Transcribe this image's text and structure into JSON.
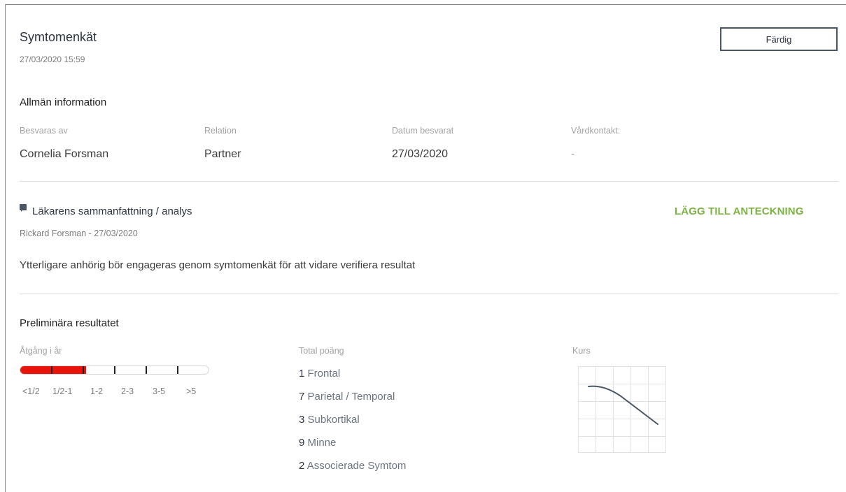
{
  "header": {
    "title": "Symtomenkät",
    "timestamp": "27/03/2020 15:59",
    "done_label": "Färdig"
  },
  "general": {
    "heading": "Allmän information",
    "fields": [
      {
        "label": "Besvaras av",
        "value": "Cornelia Forsman"
      },
      {
        "label": "Relation",
        "value": "Partner"
      },
      {
        "label": "Datum besvarat",
        "value": "27/03/2020"
      },
      {
        "label": "Vårdkontakt:",
        "value": "-"
      }
    ]
  },
  "summary": {
    "icon": "comment-icon",
    "heading": "Läkarens sammanfattning / analys",
    "add_note_label": "LÄGG TILL ANTECKNING",
    "author": "Rickard Forsman - 27/03/2020",
    "text": "Ytterligare anhörig bör engageras genom symtomenkät för att vidare verifiera resultat"
  },
  "results": {
    "heading": "Preliminära resultatet",
    "progression": {
      "label": "Åtgång i år",
      "scale": [
        "<1/2",
        "1/2-1",
        "1-2",
        "2-3",
        "3-5",
        ">5"
      ],
      "filled_segments": 2,
      "total_segments": 6,
      "fill_color": "#e8130b"
    },
    "total": {
      "label": "Total poäng",
      "items": [
        {
          "score": "1",
          "name": "Frontal"
        },
        {
          "score": "7",
          "name": "Parietal / Temporal"
        },
        {
          "score": "3",
          "name": "Subkortikal"
        },
        {
          "score": "9",
          "name": "Minne"
        },
        {
          "score": "2",
          "name": "Associerade Symtom"
        }
      ]
    },
    "course": {
      "label": "Kurs",
      "trend": "declining"
    }
  },
  "colors": {
    "accent_green": "#7cb342",
    "dark_slate": "#4a5663",
    "alert_red": "#e8130b"
  }
}
